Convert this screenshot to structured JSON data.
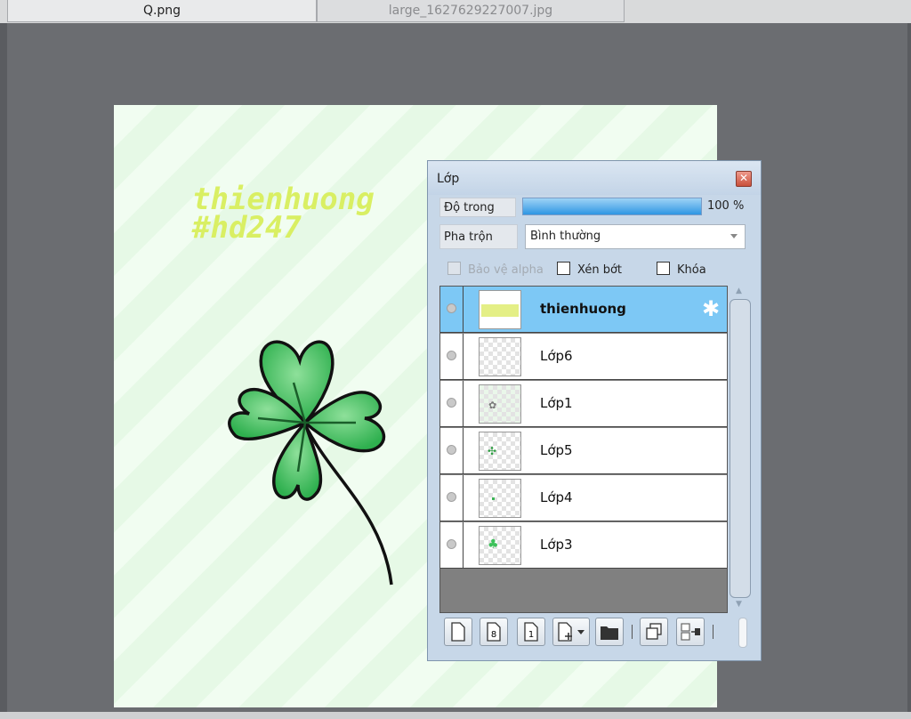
{
  "tabs": [
    {
      "label": "Q.png"
    },
    {
      "label": "large_1627629227007.jpg"
    }
  ],
  "canvas": {
    "watermark_line1": "thienhuong",
    "watermark_line2": "#hd247"
  },
  "panel": {
    "title": "Lớp",
    "opacity_label": "Độ trong",
    "opacity_value": "100 %",
    "opacity_fraction": 1.0,
    "blend_label": "Pha trộn",
    "blend_value": "Bình thường",
    "protect_alpha_label": "Bảo vệ alpha",
    "clip_label": "Xén bớt",
    "lock_label": "Khóa",
    "layers": [
      {
        "name": "thienhuong",
        "selected": true
      },
      {
        "name": "Lớp6"
      },
      {
        "name": "Lớp1"
      },
      {
        "name": "Lớp5"
      },
      {
        "name": "Lớp4"
      },
      {
        "name": "Lớp3"
      }
    ],
    "toolbar_icons": [
      "new-layer-icon",
      "new-8bit-layer-icon",
      "new-1bit-layer-icon",
      "add-layer-menu-icon",
      "new-folder-icon",
      "duplicate-layer-icon",
      "merge-layer-icon"
    ]
  },
  "colors": {
    "accent_selected": "#7dc8f5",
    "watermark": "#d9ef63",
    "workspace": "#6b6d71"
  }
}
